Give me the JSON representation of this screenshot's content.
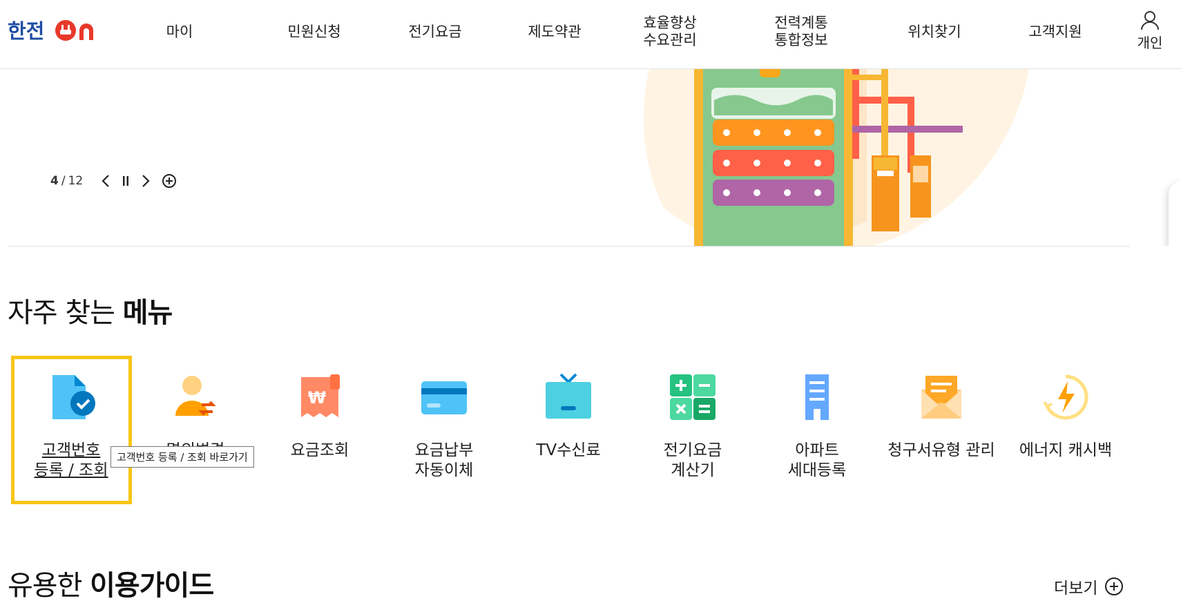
{
  "header": {
    "logo_text": "한전ON",
    "nav": [
      {
        "lines": [
          "마이"
        ]
      },
      {
        "lines": [
          "민원신청"
        ]
      },
      {
        "lines": [
          "전기요금"
        ]
      },
      {
        "lines": [
          "제도약관"
        ]
      },
      {
        "lines": [
          "효율향상",
          "수요관리"
        ]
      },
      {
        "lines": [
          "전력계통",
          "통합정보"
        ]
      },
      {
        "lines": [
          "위치찾기"
        ]
      },
      {
        "lines": [
          "고객지원"
        ]
      }
    ],
    "user_label": "개인"
  },
  "banner": {
    "pager_current": "4",
    "pager_sep": "/",
    "pager_total": "12"
  },
  "frequent_menu": {
    "title_light": "자주 찾는 ",
    "title_bold": "메뉴",
    "items": [
      {
        "lines": [
          "고객번호",
          "등록 / 조회"
        ],
        "icon": "document-check-icon",
        "color": "#4fc3f7"
      },
      {
        "lines": [
          "명의변경"
        ],
        "icon": "person-transfer-icon",
        "color": "#f9a825"
      },
      {
        "lines": [
          "요금조회"
        ],
        "icon": "won-receipt-icon",
        "color": "#ff8a65"
      },
      {
        "lines": [
          "요금납부",
          "자동이체"
        ],
        "icon": "credit-card-icon",
        "color": "#4fc3f7"
      },
      {
        "lines": [
          "TV수신료"
        ],
        "icon": "tv-icon",
        "color": "#4dd0e1"
      },
      {
        "lines": [
          "전기요금",
          "계산기"
        ],
        "icon": "calculator-icon",
        "color": "#26c281"
      },
      {
        "lines": [
          "아파트",
          "세대등록"
        ],
        "icon": "apartment-icon",
        "color": "#64a8ff"
      },
      {
        "lines": [
          "청구서유형 관리"
        ],
        "icon": "envelope-icon",
        "color": "#ffb74d"
      },
      {
        "lines": [
          "에너지 캐시백"
        ],
        "icon": "energy-cashback-icon",
        "color": "#ffa000"
      }
    ],
    "tooltip": "고객번호 등록 / 조회 바로가기"
  },
  "guide": {
    "title_light": "유용한 ",
    "title_bold": "이용가이드",
    "more_label": "더보기"
  }
}
